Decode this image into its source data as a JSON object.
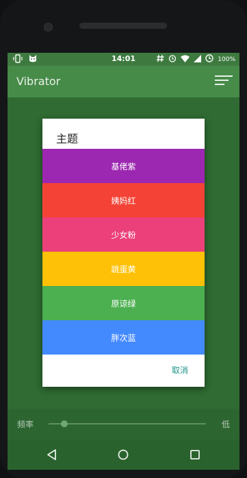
{
  "status_bar": {
    "time": "14:01",
    "battery_text": "100%",
    "left_icons": [
      "vibrate-icon",
      "cat-icon"
    ],
    "right_icons": [
      "hash-icon",
      "alarm-icon",
      "wifi-icon",
      "signal-icon",
      "battery-icon"
    ]
  },
  "app_bar": {
    "title": "Vibrator",
    "menu_icon": "sort-menu-icon"
  },
  "dialog": {
    "title": "主题",
    "items": [
      {
        "label": "基佬紫",
        "color": "#9c27b0"
      },
      {
        "label": "姨妈红",
        "color": "#f44336"
      },
      {
        "label": "少女粉",
        "color": "#ec407a"
      },
      {
        "label": "跳蛋黄",
        "color": "#ffc107"
      },
      {
        "label": "原谅绿",
        "color": "#4caf50"
      },
      {
        "label": "胖次蓝",
        "color": "#448aff"
      }
    ],
    "cancel_label": "取消"
  },
  "controls": {
    "frequency_label": "频率",
    "frequency_value": "低"
  },
  "nav_bar": {
    "icons": [
      "back-icon",
      "home-icon",
      "recents-icon"
    ]
  }
}
